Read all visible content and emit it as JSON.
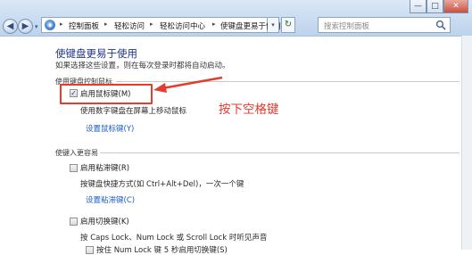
{
  "window": {
    "minimize": "—",
    "maximize": "□",
    "close": "✕"
  },
  "nav": {
    "back_icon": "arrow-left-icon",
    "forward_icon": "arrow-right-icon",
    "back_glyph": "◀",
    "forward_glyph": "▶",
    "dropdown_glyph": "▾"
  },
  "address": {
    "root_glyph": "◉",
    "breadcrumb": [
      "控制面板",
      "轻松访问",
      "轻松访问中心",
      "使键盘更易于使用"
    ],
    "separator": "▸",
    "dropdown_glyph": "▾",
    "refresh_glyph": "↻"
  },
  "search": {
    "placeholder": "搜索控制面板"
  },
  "page": {
    "title": "使键盘更易于使用",
    "subtitle": "如果选择这些设置，则在每次登录时都将自动启动。"
  },
  "section_mouse": {
    "heading": "使用键盘控制鼠标",
    "option_label": "启用鼠标键(M)",
    "option_checked": true,
    "check_glyph": "✓",
    "description": "使用数字键盘在屏幕上移动鼠标",
    "link": "设置鼠标键(Y)"
  },
  "annotation": {
    "text": "按下空格键",
    "color": "#e8392c"
  },
  "section_typing": {
    "heading": "使键入更容易",
    "sticky_label": "启用粘滞键(R)",
    "sticky_desc": "按键盘快捷方式(如 Ctrl+Alt+Del)，一次一个键",
    "sticky_link": "设置粘滞键(C)",
    "toggle_label": "启用切换键(K)",
    "toggle_desc": "按 Caps Lock、Num Lock 或 Scroll Lock 时听见声音",
    "toggle_sub": "按住 Num Lock 键 5 秒启用切换键(S)"
  }
}
